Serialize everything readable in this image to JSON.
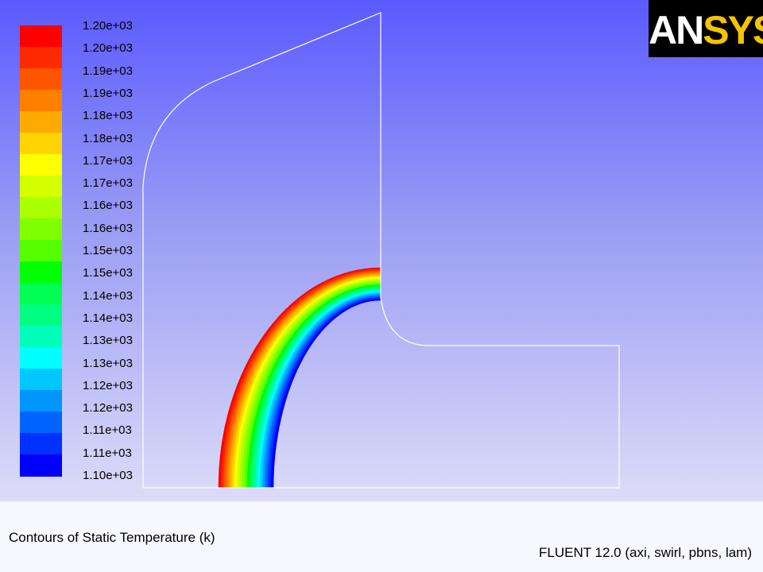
{
  "viewport": {
    "colorbar": {
      "labels": [
        "1.20e+03",
        "1.20e+03",
        "1.19e+03",
        "1.19e+03",
        "1.18e+03",
        "1.18e+03",
        "1.17e+03",
        "1.17e+03",
        "1.16e+03",
        "1.16e+03",
        "1.15e+03",
        "1.15e+03",
        "1.14e+03",
        "1.14e+03",
        "1.13e+03",
        "1.13e+03",
        "1.12e+03",
        "1.12e+03",
        "1.11e+03",
        "1.11e+03",
        "1.10e+03"
      ],
      "colors": [
        "#ff0000",
        "#ff2a00",
        "#ff5500",
        "#ff8000",
        "#ffaa00",
        "#ffd400",
        "#ffff00",
        "#d4ff00",
        "#aaff00",
        "#80ff00",
        "#55ff00",
        "#00ff00",
        "#00ff55",
        "#00ff80",
        "#00ffbb",
        "#00ffff",
        "#00c8ff",
        "#0096ff",
        "#0064ff",
        "#0032ff",
        "#0000ff"
      ]
    },
    "logo": {
      "text_main": "AN",
      "text_accent": "SYS",
      "mark": "®"
    }
  },
  "footer": {
    "title": "Contours of Static Temperature (k)",
    "solver_info": "FLUENT 12.0 (axi, swirl, pbns, lam)"
  }
}
